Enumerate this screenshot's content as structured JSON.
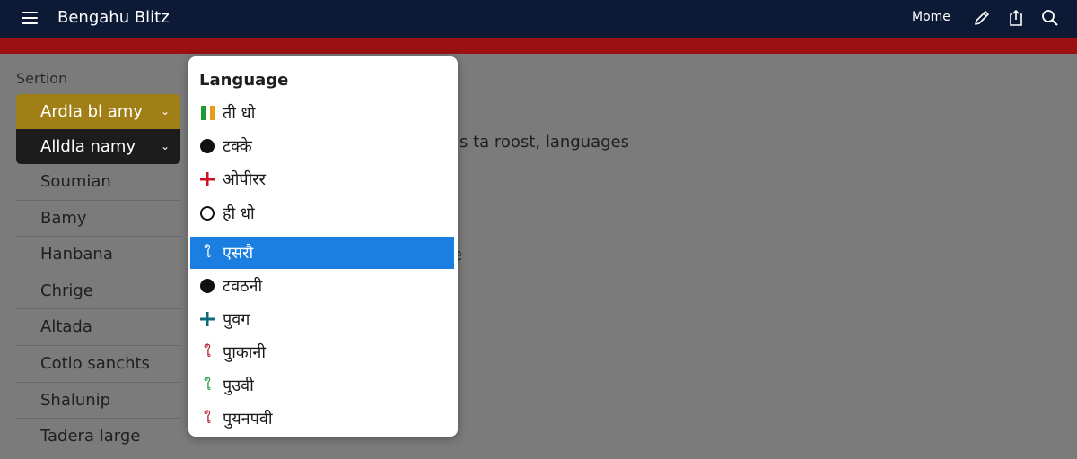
{
  "topbar": {
    "title": "Bengahu Blitz",
    "home_label": "Mome",
    "bg_color": "#0c1a36",
    "accent_strip_color": "#9b1010",
    "icons": [
      "menu-icon",
      "pencil-icon",
      "share-icon",
      "search-icon"
    ]
  },
  "sidebar": {
    "section_label": "Sertion",
    "items": [
      {
        "label": "Ardla bl amy",
        "style": "gold",
        "chevron": "⌄"
      },
      {
        "label": "Alldla namy",
        "style": "dark",
        "chevron": "⌄"
      },
      {
        "label": "Soumian"
      },
      {
        "label": "Bamy"
      },
      {
        "label": "Hanbana"
      },
      {
        "label": "Chrige"
      },
      {
        "label": "Altada"
      },
      {
        "label": "Cotlo sanchts"
      },
      {
        "label": "Shalunip"
      },
      {
        "label": "Tadera large"
      }
    ]
  },
  "background_text": {
    "line1": "s ta roost, languages",
    "line2": "e"
  },
  "language_dropdown": {
    "title": "Language",
    "selected_index": 4,
    "selected_color": "#1a7fe0",
    "items": [
      {
        "label": "ती धो",
        "icon": "india-flag-icon"
      },
      {
        "label": "टक्के",
        "icon": "filled-circle-icon"
      },
      {
        "label": "ओपीरर",
        "icon": "red-cross-icon"
      },
      {
        "label": "ही धो",
        "icon": "empty-circle-icon"
      },
      {
        "label": "एसरौ",
        "icon": "curl-icon",
        "icon_glyph": "ใ"
      },
      {
        "label": "टवठनी",
        "icon": "filled-circle-icon"
      },
      {
        "label": "पुवग",
        "icon": "teal-cross-icon"
      },
      {
        "label": "पुाकानी",
        "icon": "curl-icon",
        "icon_glyph": "ใ"
      },
      {
        "label": "पुउवी",
        "icon": "curl-icon",
        "icon_glyph": "ใ"
      },
      {
        "label": "पुयनपवी",
        "icon": "curl-icon",
        "icon_glyph": "ใ"
      }
    ]
  }
}
